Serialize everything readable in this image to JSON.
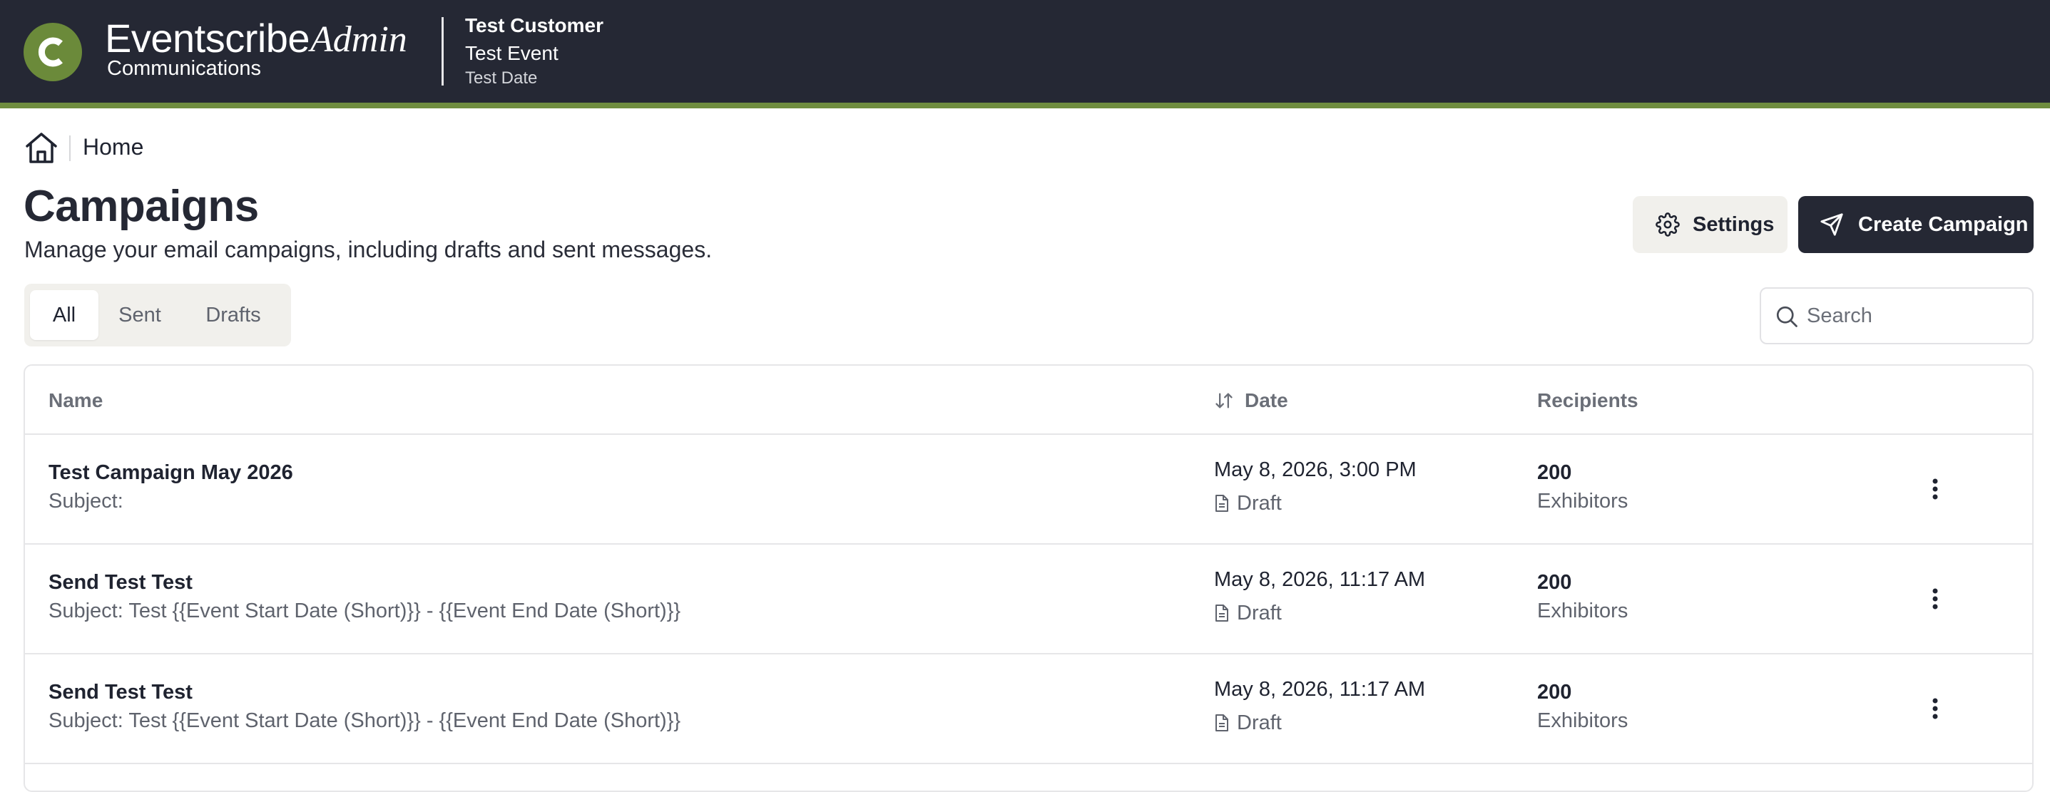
{
  "app": {
    "brand_name": "Eventscribe",
    "brand_admin": "Admin",
    "brand_sub": "Communications",
    "customer": "Test Customer",
    "event": "Test Event",
    "event_date": "Test Date",
    "accent_color": "#6f8d3f",
    "header_bg": "#252834"
  },
  "breadcrumb": {
    "home_label": "Home",
    "icon": "home-icon"
  },
  "page": {
    "title": "Campaigns",
    "description": "Manage your email campaigns, including drafts and sent messages."
  },
  "actions": {
    "settings_label": "Settings",
    "settings_icon": "gear-icon",
    "create_label": "Create Campaign",
    "create_icon": "send-icon"
  },
  "tabs": [
    {
      "label": "All",
      "active": true
    },
    {
      "label": "Sent",
      "active": false
    },
    {
      "label": "Drafts",
      "active": false
    }
  ],
  "search": {
    "placeholder": "Search",
    "value": ""
  },
  "table": {
    "headers": {
      "name": "Name",
      "date": "Date",
      "recipients": "Recipients"
    },
    "sort_icon": "sort-arrows-icon",
    "rows": [
      {
        "name": "Test Campaign May 2026",
        "subject": "Subject:",
        "date": "May 8, 2026, 3:00 PM",
        "status": "Draft",
        "count": "200",
        "recipients": "Exhibitors"
      },
      {
        "name": "Send Test Test",
        "subject": "Subject: Test {{Event Start Date (Short)}} - {{Event End Date (Short)}}",
        "date": "May 8, 2026, 11:17 AM",
        "status": "Draft",
        "count": "200",
        "recipients": "Exhibitors"
      },
      {
        "name": "Send Test Test",
        "subject": "Subject: Test {{Event Start Date (Short)}} - {{Event End Date (Short)}}",
        "date": "May 8, 2026, 11:17 AM",
        "status": "Draft",
        "count": "200",
        "recipients": "Exhibitors"
      }
    ]
  }
}
